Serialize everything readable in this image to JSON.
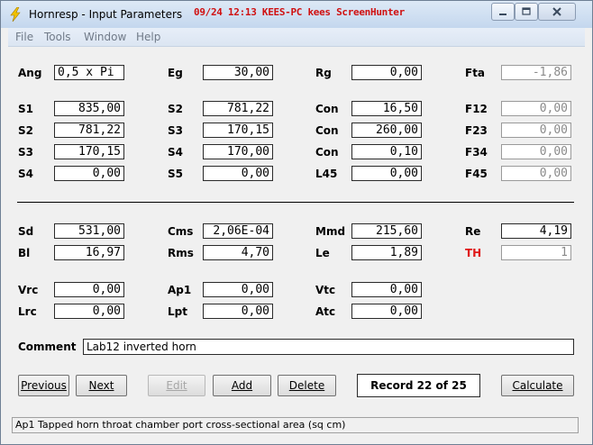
{
  "window": {
    "title": "Hornresp - Input Parameters",
    "overlay_text": "09/24 12:13 KEES-PC kees ScreenHunter"
  },
  "menu": [
    "File",
    "Tools",
    "Window",
    "Help"
  ],
  "params": {
    "Ang": "0,5 x Pi",
    "Eg": "30,00",
    "Rg": "0,00",
    "Fta": "-1,86",
    "S1": "835,00",
    "S2_col2": "781,22",
    "Con1": "16,50",
    "F12": "0,00",
    "S2": "781,22",
    "S3_col2": "170,15",
    "Con2": "260,00",
    "F23": "0,00",
    "S3": "170,15",
    "S4_col2": "170,00",
    "Con3": "0,10",
    "F34": "0,00",
    "S4": "0,00",
    "S5": "0,00",
    "L45": "0,00",
    "F45": "0,00",
    "Sd": "531,00",
    "Cms": "2,06E-04",
    "Mmd": "215,60",
    "Re": "4,19",
    "Bl": "16,97",
    "Rms": "4,70",
    "Le": "1,89",
    "TH": "1",
    "Vrc": "0,00",
    "Ap1": "0,00",
    "Vtc": "0,00",
    "Lrc": "0,00",
    "Lpt": "0,00",
    "Atc": "0,00"
  },
  "labels": {
    "Ang": "Ang",
    "Eg": "Eg",
    "Rg": "Rg",
    "Fta": "Fta",
    "S1": "S1",
    "S2": "S2",
    "S3": "S3",
    "S4": "S4",
    "S5": "S5",
    "Con": "Con",
    "L45": "L45",
    "F12": "F12",
    "F23": "F23",
    "F34": "F34",
    "F45": "F45",
    "Sd": "Sd",
    "Cms": "Cms",
    "Mmd": "Mmd",
    "Re": "Re",
    "Bl": "Bl",
    "Rms": "Rms",
    "Le": "Le",
    "TH": "TH",
    "Vrc": "Vrc",
    "Ap1": "Ap1",
    "Vtc": "Vtc",
    "Lrc": "Lrc",
    "Lpt": "Lpt",
    "Atc": "Atc",
    "Comment": "Comment"
  },
  "comment": "Lab12 inverted horn",
  "buttons": {
    "previous": "Previous",
    "next": "Next",
    "edit": "Edit",
    "add": "Add",
    "delete": "Delete",
    "calculate": "Calculate"
  },
  "record": "Record 22 of 25",
  "status": "Ap1    Tapped horn throat chamber port cross-sectional area  (sq cm)",
  "colors": {
    "titlebar": "#c4d7ee",
    "highlight_label": "#e01818",
    "overlay": "#d01010"
  }
}
